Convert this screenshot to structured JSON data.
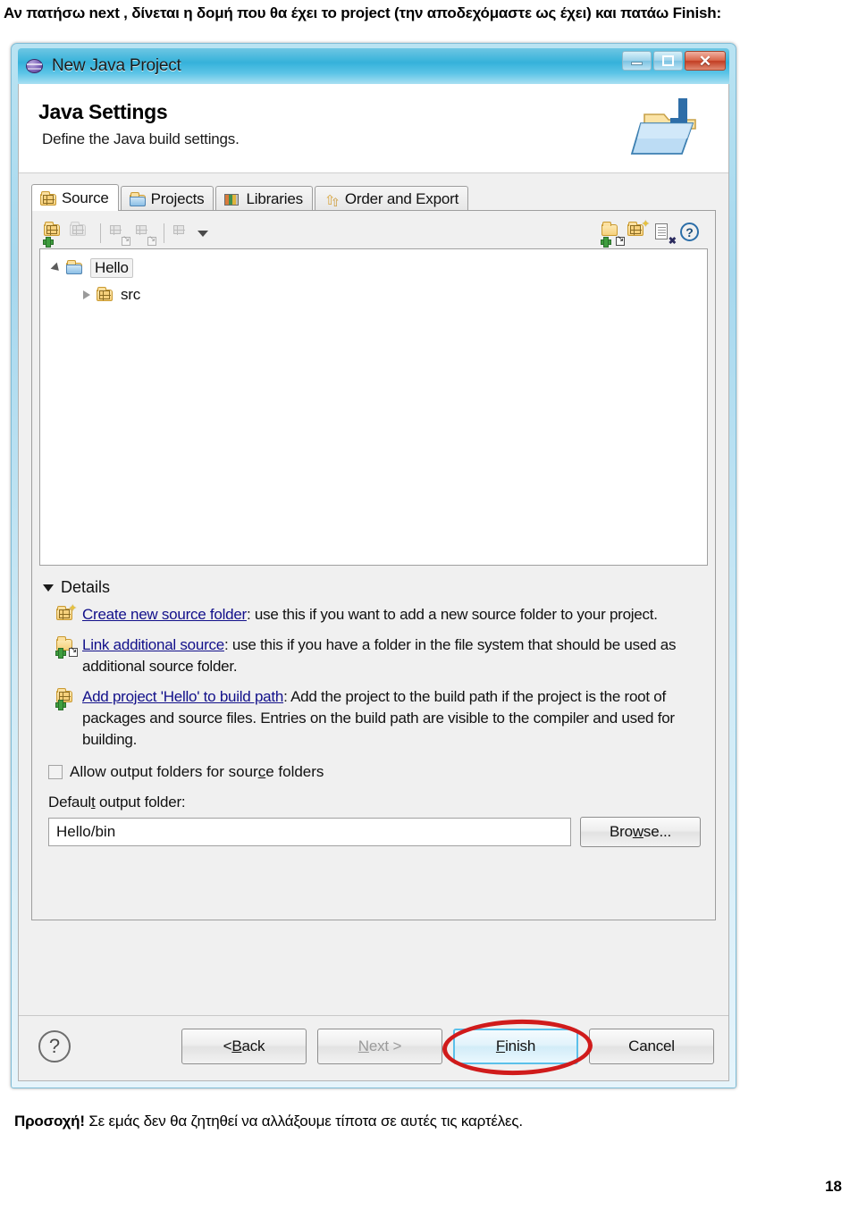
{
  "document": {
    "top_text": "Αν πατήσω next , δίνεται η  δομή που θα έχει το project (την αποδεχόμαστε ως έχει) και πατάω Finish:",
    "bottom_text_strong": "Προσοχή!",
    "bottom_text_rest": " Σε εμάς δεν θα ζητηθεί να αλλάξουμε τίποτα σε αυτές τις καρτέλες.",
    "page_number": "18"
  },
  "window": {
    "title": "New Java Project",
    "icon": "eclipse-globe-icon",
    "controls": {
      "minimize": "minimize-icon",
      "maximize": "maximize-icon",
      "close": "close-icon"
    }
  },
  "banner": {
    "title": "Java Settings",
    "subtitle": "Define the Java build settings.",
    "icon": "java-folder-wizard-icon"
  },
  "tabs": [
    {
      "label": "Source",
      "icon": "package-folder-icon",
      "active": true
    },
    {
      "label": "Projects",
      "icon": "open-folder-icon",
      "active": false
    },
    {
      "label": "Libraries",
      "icon": "books-icon",
      "active": false
    },
    {
      "label": "Order and Export",
      "icon": "order-arrows-icon",
      "active": false
    }
  ],
  "toolbar": {
    "left": [
      {
        "name": "add-folder-icon",
        "enabled": true
      },
      {
        "name": "remove-folder-icon",
        "enabled": false
      },
      {
        "name": "link-source-in-icon",
        "enabled": false
      },
      {
        "name": "link-source-out-icon",
        "enabled": false
      },
      {
        "name": "configure-filters-icon",
        "enabled": false
      }
    ],
    "menu_caret": "dropdown-caret-icon",
    "right": [
      {
        "name": "link-additional-source-icon",
        "enabled": true
      },
      {
        "name": "create-new-source-folder-icon",
        "enabled": true
      },
      {
        "name": "remove-entry-icon",
        "enabled": true
      },
      {
        "name": "help-icon",
        "enabled": true
      }
    ]
  },
  "tree": {
    "root": {
      "label": "Hello",
      "icon": "java-project-folder-icon",
      "expanded": true,
      "selected": true
    },
    "children": [
      {
        "label": "src",
        "icon": "source-folder-icon",
        "expanded": false
      }
    ]
  },
  "details": {
    "header": "Details",
    "expanded": true,
    "items": [
      {
        "icon": "create-new-source-folder-icon",
        "link": "Create new source folder",
        "text": ": use this if you want to add a new source folder to your project."
      },
      {
        "icon": "link-additional-source-icon",
        "link": "Link additional source",
        "text": ": use this if you have a folder in the file system that should be used as additional source folder."
      },
      {
        "icon": "add-to-build-path-icon",
        "link": "Add project 'Hello' to build path",
        "text": ": Add the project to the build path if the project is the root of packages and source files. Entries on the build path are visible to the compiler and used for building."
      }
    ]
  },
  "options": {
    "allow_output_folders": {
      "label_before": "Allow output folders for sour",
      "label_accel": "c",
      "label_after": "e folders",
      "checked": false
    },
    "default_output_folder": {
      "label_before": "Defaul",
      "label_accel": "t",
      "label_after": " output folder:",
      "value": "Hello/bin"
    },
    "browse_button": {
      "label_before": "Bro",
      "label_accel": "w",
      "label_after": "se..."
    }
  },
  "footer": {
    "help_icon": "help-question-icon",
    "buttons": [
      {
        "name": "back-button",
        "label_before": "< ",
        "label_accel": "B",
        "label_after": "ack",
        "enabled": true,
        "default": false
      },
      {
        "name": "next-button",
        "label_before": "",
        "label_accel": "N",
        "label_after": "ext >",
        "enabled": false,
        "default": false
      },
      {
        "name": "finish-button",
        "label_before": "",
        "label_accel": "F",
        "label_after": "inish",
        "enabled": true,
        "default": true
      },
      {
        "name": "cancel-button",
        "label_before": "",
        "label_accel": "",
        "label_after": "Cancel",
        "enabled": true,
        "default": false
      }
    ],
    "annotation": {
      "shape": "red-ellipse",
      "target": "finish-button",
      "color": "#d01b1b"
    }
  }
}
